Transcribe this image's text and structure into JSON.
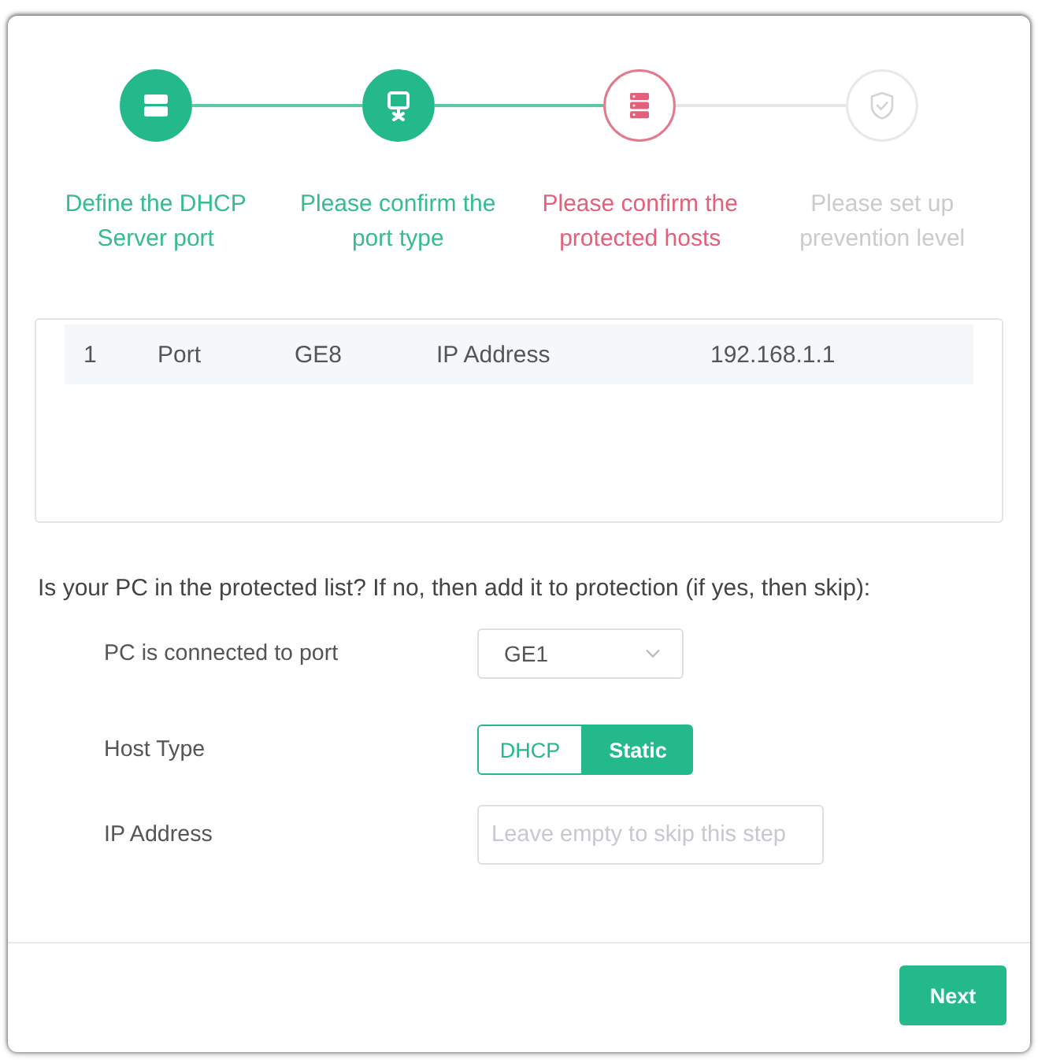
{
  "steps": [
    {
      "label": "Define the DHCP Server port",
      "done": true,
      "selected": false
    },
    {
      "label": "Please confirm the port type",
      "done": true,
      "selected": false
    },
    {
      "label": "Please confirm the protected hosts",
      "done": false,
      "selected": true
    },
    {
      "label": "Please set up prevention level",
      "done": false,
      "selected": false
    }
  ],
  "table": {
    "rows": [
      {
        "cells": [
          "1",
          "Port",
          "GE8",
          "IP Address",
          "192.168.1.1"
        ]
      }
    ]
  },
  "question": "Is your PC in the protected list? If no, then add it to protection (if yes, then skip):",
  "form": {
    "fields": [
      {
        "kind": "select",
        "label": "PC is connected to port",
        "value": "GE1"
      },
      {
        "kind": "toggle",
        "label": "Host Type",
        "options": [
          {
            "label": "DHCP",
            "selected": false
          },
          {
            "label": "Static",
            "selected": true
          }
        ]
      },
      {
        "kind": "input",
        "label": "IP Address",
        "placeholder": "Leave empty to skip this step"
      }
    ]
  },
  "buttons": [
    {
      "label": "Next"
    }
  ]
}
